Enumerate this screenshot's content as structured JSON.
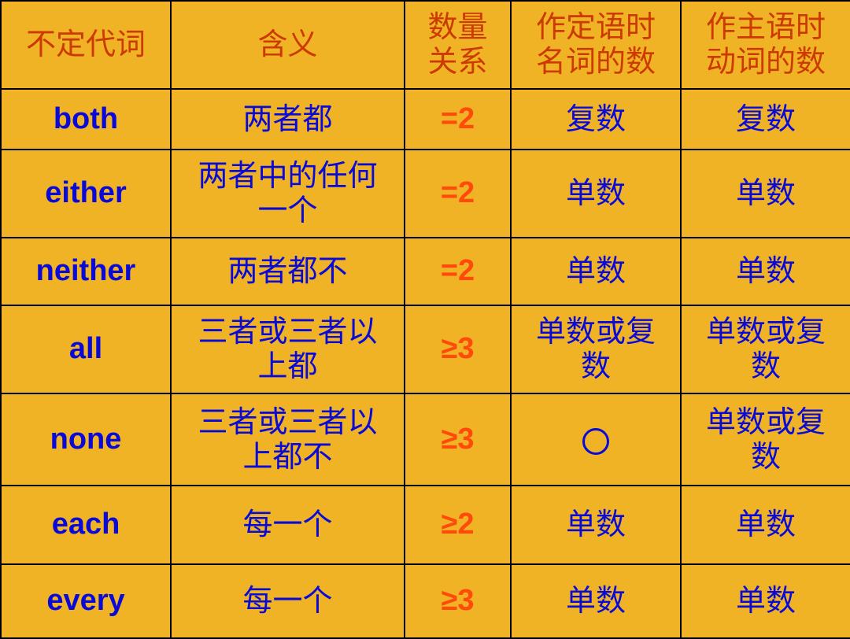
{
  "table": {
    "headers": [
      "不定代词",
      "含义",
      "数量关系",
      "作定语时名词的数",
      "作主语时动词的数"
    ],
    "rows": [
      {
        "word": "both",
        "meaning": "两者都",
        "relation": "=2",
        "noun_number": "复数",
        "verb_number": "复数"
      },
      {
        "word": "either",
        "meaning": "两者中的任何一个",
        "relation": "=2",
        "noun_number": "单数",
        "verb_number": "单数"
      },
      {
        "word": "neither",
        "meaning": "两者都不",
        "relation": "=2",
        "noun_number": "单数",
        "verb_number": "单数"
      },
      {
        "word": "all",
        "meaning": "三者或三者以上都",
        "relation": "≥3",
        "noun_number": "单数或复数",
        "verb_number": "单数或复数"
      },
      {
        "word": "none",
        "meaning": "三者或三者以上都不",
        "relation": "≥3",
        "noun_number": "",
        "noun_number_icon": "circle-icon",
        "verb_number": "单数或复数"
      },
      {
        "word": "each",
        "meaning": "每一个",
        "relation": "≥2",
        "noun_number": "单数",
        "verb_number": "单数"
      },
      {
        "word": "every",
        "meaning": "每一个",
        "relation": "≥3",
        "noun_number": "单数",
        "verb_number": "单数"
      }
    ]
  }
}
